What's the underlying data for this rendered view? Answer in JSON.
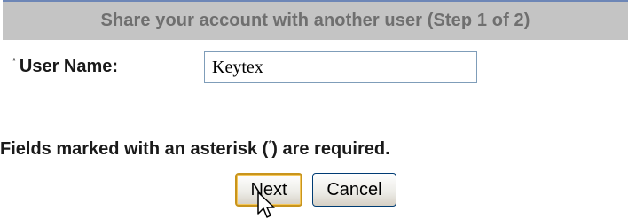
{
  "header": {
    "title": "Share your account with another user (Step 1 of 2)"
  },
  "form": {
    "username_asterisk": "*",
    "username_label": "User Name:",
    "username_value": "Keytex"
  },
  "note": {
    "before": "Fields marked with an asterisk (",
    "asterisk": "*",
    "after": ") are required."
  },
  "buttons": {
    "next_label": "Next",
    "cancel_label": "Cancel"
  },
  "colors": {
    "header_bg": "#c4c4c4",
    "header_border": "#6d86b6",
    "header_text": "#6f6f6f",
    "default_button_highlight": "#c8941c"
  },
  "icons": {
    "pointer": "mouse-pointer-icon"
  }
}
